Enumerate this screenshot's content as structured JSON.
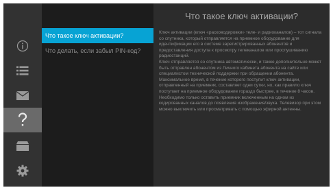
{
  "sidebar": {
    "items": [
      {
        "icon": "info-icon"
      },
      {
        "icon": "list-icon"
      },
      {
        "icon": "mail-icon"
      },
      {
        "icon": "help-icon",
        "active": true
      },
      {
        "icon": "card-icon"
      },
      {
        "icon": "settings-icon"
      }
    ]
  },
  "menu": {
    "items": [
      {
        "label": "Что такое ключ активации?",
        "active": true
      },
      {
        "label": "Что делать, если забыл PIN-код?",
        "active": false
      }
    ]
  },
  "content": {
    "title": "Что такое ключ активации?",
    "paragraphs": [
      "Ключ активации (ключ «расководировки» теле- и радиоканалов) – тот сигнала со спутника, который отправляется на приемное оборудование для идентификации его в системе зарегистрированных абонентов и предоставления доступа к просмотру телеканалов или прослушиванию радиостанций.",
      "Ключ отправляется со спутника автоматически, и также дополнительно может быть отправлен абонентом из Личного кабинета абонента на сайте или специалистом технической поддержки при обращении абонента.",
      "Максимальное время, в течение которого поступит ключ активации, отправленный на приемник, составляет одни сутки, но, как правило ключ поступает на приемное оборудование гораздо быстрее, в течение 8 часов.",
      "Необходимо только оставить приемник включенным на одном из кодированных каналов до появления изображения/звука. Телевизор при этом можно выключить или просматривать с помощью эфирной антенны."
    ]
  },
  "colors": {
    "accent": "#07a3d4",
    "rail": "#323232",
    "menu": "#1c1c1c",
    "content": "#2c2c2c"
  }
}
